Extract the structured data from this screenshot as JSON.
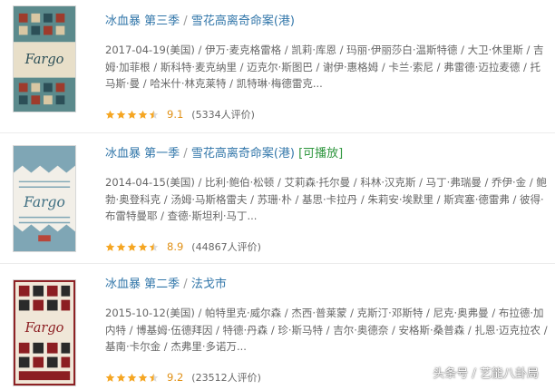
{
  "items": [
    {
      "title": "冰血暴 第三季",
      "separator": "/",
      "alt_title": "雪花高离奇命案(港)",
      "playable": "",
      "meta": "2017-04-19(美国) / 伊万·麦克格雷格 / 凯莉·库恩 / 玛丽·伊丽莎白·温斯特德 / 大卫·休里斯 / 吉姆·加菲根 / 斯科特·麦克纳里 / 迈克尔·斯图巴 / 谢伊·惠格姆 / 卡兰·索尼 / 弗雷德·迈拉麦德 / 托马斯·曼 / 哈米什·林克莱特 / 凯特琳·梅德雷克...",
      "stars": 4.5,
      "score": "9.1",
      "votes": "(5334人评价)",
      "poster_brand": "Fargo",
      "poster_colors": [
        "#5b8a8c",
        "#9e3b2c",
        "#d9c7a3"
      ]
    },
    {
      "title": "冰血暴 第一季",
      "separator": "/",
      "alt_title": "雪花高离奇命案(港)",
      "playable": "[可播放]",
      "meta": "2014-04-15(美国) / 比利·鲍伯·松顿 / 艾莉森·托尔曼 / 科林·汉克斯 / 马丁·弗瑞曼 / 乔伊·金 / 鲍勃·奥登科克 / 汤姆·马斯格雷夫 / 苏珊·朴 / 基思·卡拉丹 / 朱莉安·埃默里 / 斯宾塞·德雷弗 / 彼得·布雷特曼耶 / 查德·斯坦利·马丁...",
      "stars": 4.5,
      "score": "8.9",
      "votes": "(44867人评价)",
      "poster_brand": "Fargo",
      "poster_colors": [
        "#7fa6b5",
        "#f2efe8",
        "#b8463a"
      ]
    },
    {
      "title": "冰血暴 第二季",
      "separator": "/",
      "alt_title": "法戈市",
      "playable": "",
      "meta": "2015-10-12(美国) / 帕特里克·威尔森 / 杰西·普莱蒙 / 克斯汀·邓斯特 / 尼克·奥弗曼 / 布拉德·加内特 / 博基姆·伍德拜因 / 特德·丹森 / 珍·斯马特 / 吉尔·奥德奈 / 安格斯·桑普森 / 扎恩·迈克拉农 / 基南·卡尔金 / 杰弗里·多诺万...",
      "stars": 4.5,
      "score": "9.2",
      "votes": "(23512人评价)",
      "poster_brand": "Fargo",
      "poster_colors": [
        "#8c1e22",
        "#f0e7d8",
        "#2a2a2a"
      ]
    }
  ],
  "watermark": {
    "text": "头条号 / 艺能八卦局",
    "icon": "search-circle-icon"
  },
  "colors": {
    "link": "#3377aa",
    "playable": "#2e963d",
    "star": "#f5a623",
    "score": "#e09015"
  }
}
